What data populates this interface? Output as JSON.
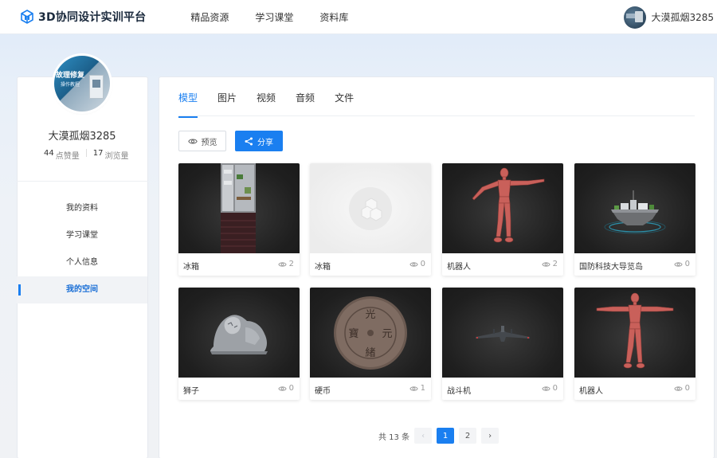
{
  "header": {
    "logo_text": "3D协同设计实训平台",
    "nav": [
      {
        "label": "精品资源"
      },
      {
        "label": "学习课堂"
      },
      {
        "label": "资料库"
      }
    ],
    "user_name": "大漠孤烟3285"
  },
  "profile": {
    "avatar_text_line1": "故理修复",
    "avatar_text_line2": "操作教程",
    "name": "大漠孤烟3285",
    "likes_count": "44",
    "likes_label": "点赞量",
    "views_count": "17",
    "views_label": "浏览量"
  },
  "sidebar": {
    "items": [
      {
        "label": "我的资料"
      },
      {
        "label": "学习课堂"
      },
      {
        "label": "个人信息"
      },
      {
        "label": "我的空间"
      }
    ],
    "active_index": 3
  },
  "tabs": [
    {
      "label": "模型"
    },
    {
      "label": "图片"
    },
    {
      "label": "视频"
    },
    {
      "label": "音频"
    },
    {
      "label": "文件"
    }
  ],
  "toolbar": {
    "preview_label": "预览",
    "share_label": "分享"
  },
  "cards": [
    {
      "title": "冰箱",
      "views": "2",
      "thumb": "fridge"
    },
    {
      "title": "冰箱",
      "views": "0",
      "thumb": "placeholder"
    },
    {
      "title": "机器人",
      "views": "2",
      "thumb": "mannequin"
    },
    {
      "title": "国防科技大导览岛",
      "views": "0",
      "thumb": "island"
    },
    {
      "title": "狮子",
      "views": "0",
      "thumb": "lion"
    },
    {
      "title": "硬币",
      "views": "1",
      "thumb": "coin"
    },
    {
      "title": "战斗机",
      "views": "0",
      "thumb": "jet"
    },
    {
      "title": "机器人",
      "views": "0",
      "thumb": "mannequin"
    }
  ],
  "coin_chars": {
    "top": "光",
    "left": "寶",
    "right": "元",
    "bottom": "緒"
  },
  "pagination": {
    "total_text": "共 13 条",
    "prev": "‹",
    "pages": [
      "1",
      "2"
    ],
    "current": "1",
    "next": "›"
  },
  "colors": {
    "accent": "#1a7ff0"
  }
}
